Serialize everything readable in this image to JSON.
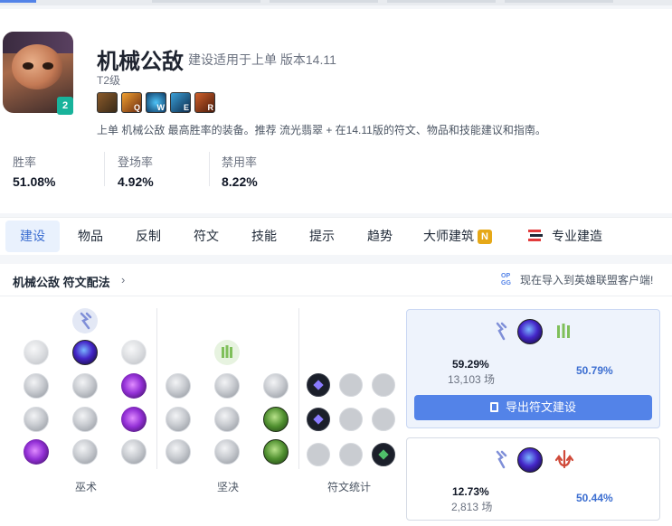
{
  "champion": {
    "name": "机械公敌",
    "subtitle": "建设适用于上单 版本14.11",
    "tier": "T2级",
    "tier_badge": "2",
    "description": "上单 机械公敌 最高胜率的装备。推荐 流光翡翠 + 在14.11版的符文、物品和技能建议和指南。",
    "skills": [
      {
        "key": "",
        "icon": "passive-icon"
      },
      {
        "key": "Q",
        "icon": "q-skill-icon"
      },
      {
        "key": "W",
        "icon": "w-skill-icon"
      },
      {
        "key": "E",
        "icon": "e-skill-icon"
      },
      {
        "key": "R",
        "icon": "r-skill-icon"
      }
    ]
  },
  "stats": [
    {
      "label": "胜率",
      "value": "51.08%"
    },
    {
      "label": "登场率",
      "value": "4.92%"
    },
    {
      "label": "禁用率",
      "value": "8.22%"
    }
  ],
  "tabs": [
    {
      "label": "建设",
      "active": true
    },
    {
      "label": "物品"
    },
    {
      "label": "反制"
    },
    {
      "label": "符文"
    },
    {
      "label": "技能"
    },
    {
      "label": "提示"
    },
    {
      "label": "趋势"
    },
    {
      "label": "大师建筑",
      "badge": "N"
    },
    {
      "label": "专业建造"
    }
  ],
  "runes_panel": {
    "title": "机械公敌 符文配法",
    "chevron": "›",
    "import_text": "现在导入到英雄联盟客户端!",
    "col_labels": [
      "巫术",
      "坚决",
      "符文统计"
    ]
  },
  "rune_pages": [
    {
      "pick_rate": "59.29%",
      "games": "13,103 场",
      "win_rate": "50.79%",
      "export_label": "导出符文建设"
    },
    {
      "pick_rate": "12.73%",
      "games": "2,813 场",
      "win_rate": "50.44%"
    }
  ],
  "colors": {
    "accent": "#5383e8",
    "win_rate": "#3d6fd1",
    "tier_badge": "#18b39b",
    "new_badge": "#e6a817"
  }
}
